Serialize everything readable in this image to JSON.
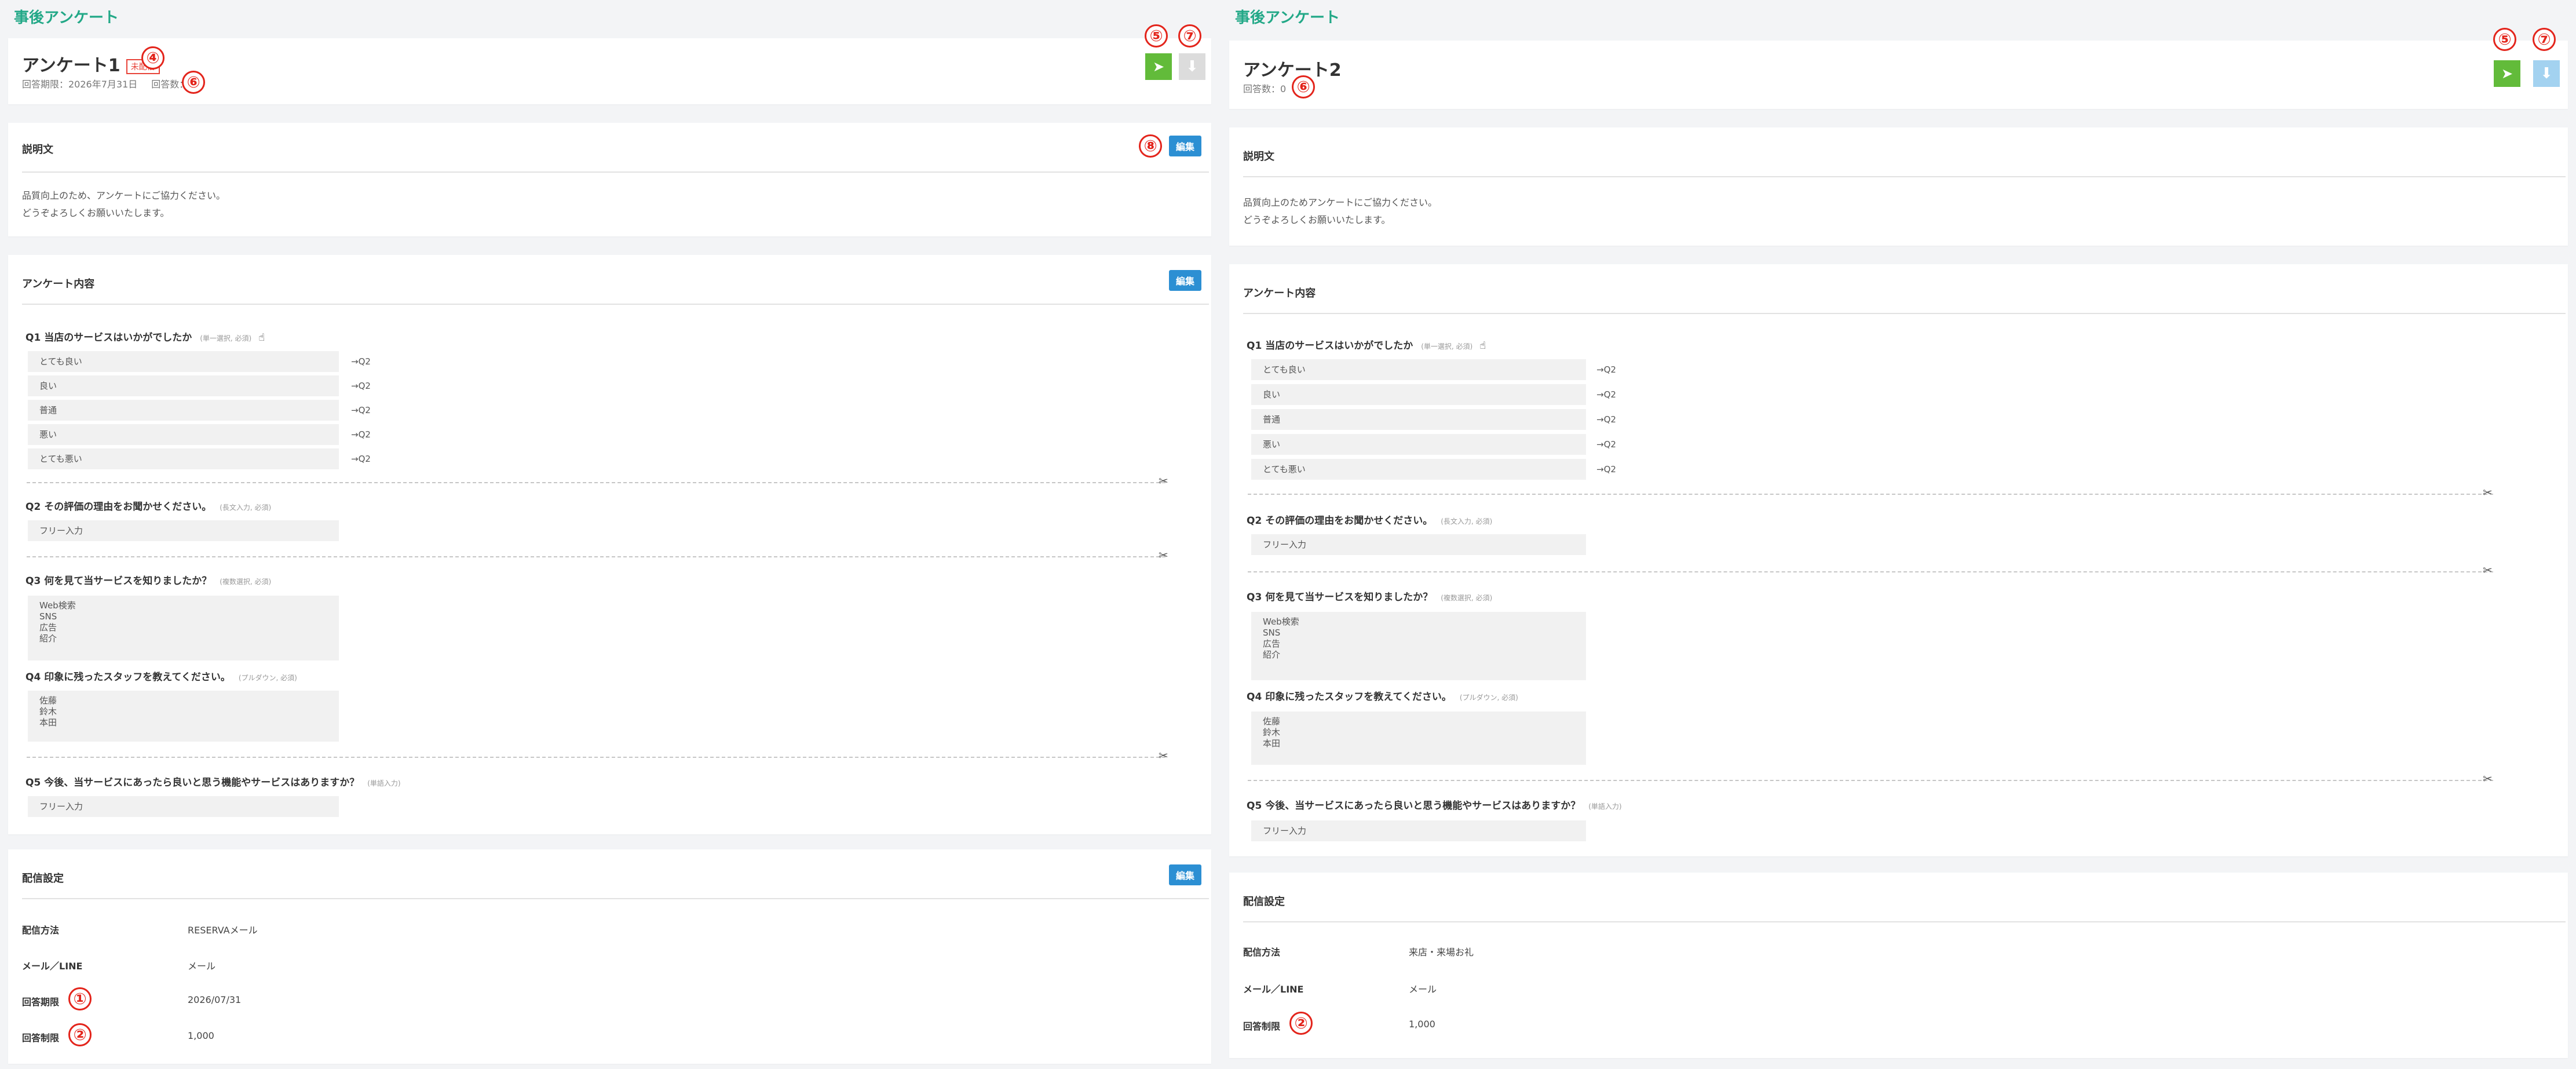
{
  "left": {
    "section_title": "事後アンケート",
    "survey": {
      "name": "アンケート1",
      "badge": "未配信",
      "deadline": "回答期限：2026年7月31日",
      "count": "回答数：0"
    },
    "markers": {
      "badge": "④",
      "send": "⑤",
      "download": "⑦",
      "count": "⑥",
      "edit_desc": "⑧",
      "deadline": "①",
      "limit": "②"
    },
    "description": {
      "title": "説明文",
      "edit_label": "編集",
      "lines": [
        "品質向上のため、アンケートにご協力ください。",
        "どうぞよろしくお願いいたします。"
      ]
    },
    "content": {
      "title": "アンケート内容",
      "edit_label": "編集",
      "q1": {
        "title": "Q1 当店のサービスはいかがでしたか",
        "hint": "(単一選択, 必須)",
        "options": [
          "とても良い",
          "良い",
          "普通",
          "悪い",
          "とても悪い"
        ],
        "targets": [
          "→Q2",
          "→Q2",
          "→Q2",
          "→Q2",
          "→Q2"
        ]
      },
      "q2": {
        "title": "Q2 その評価の理由をお聞かせください。",
        "hint": "(長文入力, 必須)",
        "placeholder": "フリー入力"
      },
      "q3": {
        "title": "Q3 何を見て当サービスを知りましたか？",
        "hint": "(複数選択, 必須)",
        "options": [
          "Web検索",
          "SNS",
          "広告",
          "紹介"
        ]
      },
      "q4": {
        "title": "Q4 印象に残ったスタッフを教えてください。",
        "hint": "(プルダウン, 必須)",
        "options": [
          "佐藤",
          "鈴木",
          "本田"
        ]
      },
      "q5": {
        "title": "Q5 今後、当サービスにあったら良いと思う機能やサービスはありますか？",
        "hint": "(単語入力)",
        "placeholder": "フリー入力"
      }
    },
    "distribution": {
      "title": "配信設定",
      "edit_label": "編集",
      "method_label": "配信方法",
      "method_value": "RESERVAメール",
      "channel_label": "メール／LINE",
      "channel_value": "メール",
      "deadline_label": "回答期限",
      "deadline_value": "2026/07/31",
      "limit_label": "回答制限",
      "limit_value": "1,000"
    }
  },
  "right": {
    "section_title": "事後アンケート",
    "survey": {
      "name": "アンケート2",
      "count": "回答数：0"
    },
    "markers": {
      "send": "⑤",
      "download": "⑦",
      "count": "⑥",
      "limit": "②"
    },
    "description": {
      "title": "説明文",
      "lines": [
        "品質向上のためアンケートにご協力ください。",
        "どうぞよろしくお願いいたします。"
      ]
    },
    "content": {
      "title": "アンケート内容",
      "q1": {
        "title": "Q1 当店のサービスはいかがでしたか",
        "hint": "(単一選択, 必須)",
        "options": [
          "とても良い",
          "良い",
          "普通",
          "悪い",
          "とても悪い"
        ],
        "targets": [
          "→Q2",
          "→Q2",
          "→Q2",
          "→Q2",
          "→Q2"
        ]
      },
      "q2": {
        "title": "Q2 その評価の理由をお聞かせください。",
        "hint": "(長文入力, 必須)",
        "placeholder": "フリー入力"
      },
      "q3": {
        "title": "Q3 何を見て当サービスを知りましたか？",
        "hint": "(複数選択, 必須)",
        "options": [
          "Web検索",
          "SNS",
          "広告",
          "紹介"
        ]
      },
      "q4": {
        "title": "Q4 印象に残ったスタッフを教えてください。",
        "hint": "(プルダウン, 必須)",
        "options": [
          "佐藤",
          "鈴木",
          "本田"
        ]
      },
      "q5": {
        "title": "Q5 今後、当サービスにあったら良いと思う機能やサービスはありますか？",
        "hint": "(単語入力)",
        "placeholder": "フリー入力"
      }
    },
    "distribution": {
      "title": "配信設定",
      "method_label": "配信方法",
      "method_value": "来店・来場お礼",
      "channel_label": "メール／LINE",
      "channel_value": "メール",
      "limit_label": "回答制限",
      "limit_value": "1,000"
    }
  },
  "icons": {
    "send": "paper-plane-icon",
    "download": "download-icon",
    "scissor": "scissors-icon",
    "hand": "pointer-hand-icon"
  },
  "colors": {
    "accent_teal": "#22a887",
    "send_green": "#62bb3a",
    "edit_blue": "#2c8fd3",
    "marker_red": "#e3241b"
  }
}
